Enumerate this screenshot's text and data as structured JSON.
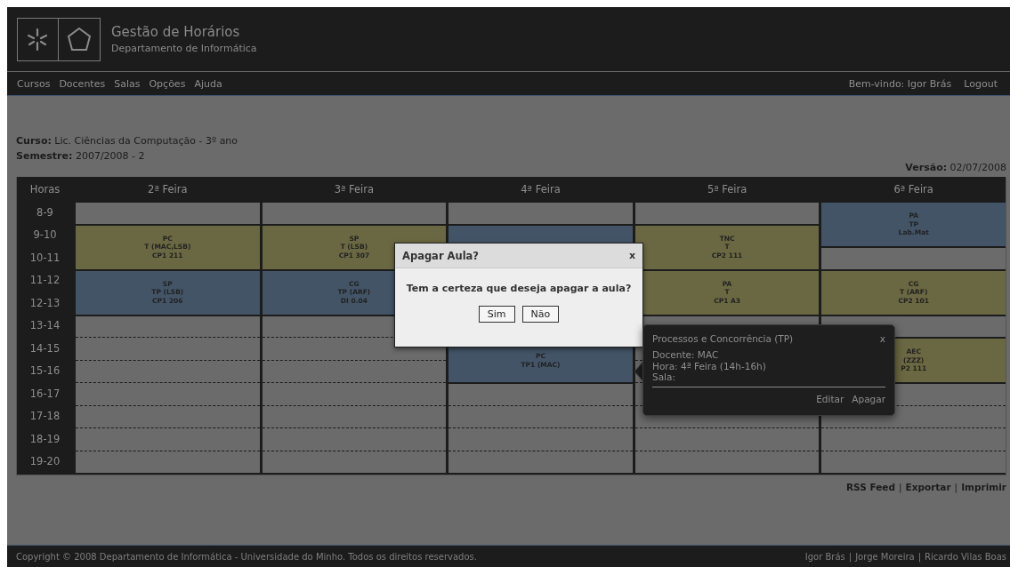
{
  "header": {
    "title": "Gestão de Horários",
    "subtitle": "Departamento de Informática"
  },
  "nav": {
    "items": [
      "Cursos",
      "Docentes",
      "Salas",
      "Opções",
      "Ajuda"
    ],
    "welcome": "Bem-vindo: Igor Brás",
    "logout": "Logout"
  },
  "info": {
    "course_label": "Curso:",
    "course": "Lic. Ciências da Computação - 3º ano",
    "semester_label": "Semestre:",
    "semester": "2007/2008 - 2",
    "version_label": "Versão:",
    "version": "02/07/2008"
  },
  "timetable": {
    "hours_heading": "Horas",
    "hours": [
      "8-9",
      "9-10",
      "10-11",
      "11-12",
      "12-13",
      "13-14",
      "14-15",
      "15-16",
      "16-17",
      "17-18",
      "18-19",
      "19-20"
    ],
    "days": [
      {
        "name": "2ª Feira",
        "slots": [
          {
            "kind": "free"
          },
          {
            "kind": "lesson",
            "color": "#6a6842",
            "lines": [
              "PC",
              "T (MAC,LSB)",
              "CP1 211"
            ]
          },
          {
            "kind": "continued"
          },
          {
            "kind": "lesson",
            "color": "#435467",
            "lines": [
              "SP",
              "TP (LSB)",
              "CP1 206"
            ]
          },
          {
            "kind": "continued"
          },
          {
            "kind": "free"
          },
          {
            "kind": "free"
          },
          {
            "kind": "free"
          },
          {
            "kind": "free"
          },
          {
            "kind": "free"
          },
          {
            "kind": "free"
          },
          {
            "kind": "free"
          }
        ]
      },
      {
        "name": "3ª Feira",
        "slots": [
          {
            "kind": "free"
          },
          {
            "kind": "lesson",
            "color": "#6a6842",
            "lines": [
              "SP",
              "T (LSB)",
              "CP1 307"
            ]
          },
          {
            "kind": "continued"
          },
          {
            "kind": "lesson",
            "color": "#435467",
            "lines": [
              "CG",
              "TP (ARF)",
              "DI 0.04"
            ]
          },
          {
            "kind": "continued"
          },
          {
            "kind": "free"
          },
          {
            "kind": "free"
          },
          {
            "kind": "free"
          },
          {
            "kind": "free"
          },
          {
            "kind": "free"
          },
          {
            "kind": "free"
          },
          {
            "kind": "free"
          }
        ]
      },
      {
        "name": "4ª Feira",
        "slots": [
          {
            "kind": "free"
          },
          {
            "kind": "lesson",
            "color": "#435467"
          },
          {
            "kind": "continued"
          },
          {
            "kind": "covered"
          },
          {
            "kind": "covered"
          },
          {
            "kind": "covered"
          },
          {
            "kind": "lesson",
            "color": "#435467",
            "lines": [
              "PC",
              "TP1 (MAC)"
            ]
          },
          {
            "kind": "continued"
          },
          {
            "kind": "free"
          },
          {
            "kind": "free"
          },
          {
            "kind": "free"
          },
          {
            "kind": "free"
          }
        ]
      },
      {
        "name": "5ª Feira",
        "slots": [
          {
            "kind": "free"
          },
          {
            "kind": "lesson",
            "color": "#6a6842",
            "lines": [
              "TNC",
              "T",
              "CP2 111"
            ]
          },
          {
            "kind": "continued"
          },
          {
            "kind": "lesson",
            "color": "#6a6842",
            "lines": [
              "PA",
              "T",
              "CP1 A3"
            ]
          },
          {
            "kind": "continued"
          },
          {
            "kind": "free"
          },
          {
            "kind": "free"
          },
          {
            "kind": "free"
          },
          {
            "kind": "free"
          },
          {
            "kind": "free"
          },
          {
            "kind": "free"
          },
          {
            "kind": "free"
          }
        ]
      },
      {
        "name": "6ª Feira",
        "slots": [
          {
            "kind": "lesson",
            "color": "#435467",
            "lines": [
              "PA",
              "TP",
              "Lab.Mat"
            ]
          },
          {
            "kind": "continued"
          },
          {
            "kind": "free"
          },
          {
            "kind": "lesson",
            "color": "#6a6842",
            "lines": [
              "CG",
              "T (ARF)",
              "CP2 101"
            ]
          },
          {
            "kind": "continued"
          },
          {
            "kind": "free"
          },
          {
            "kind": "lesson",
            "color": "#6a6842",
            "lines": [
              "AEC",
              "(ZZZ)",
              "P2 111"
            ]
          },
          {
            "kind": "continued"
          },
          {
            "kind": "free"
          },
          {
            "kind": "free"
          },
          {
            "kind": "free"
          },
          {
            "kind": "free"
          }
        ]
      }
    ]
  },
  "links": {
    "items": [
      "RSS Feed",
      "Exportar",
      "Imprimir"
    ],
    "separator": "|"
  },
  "dialog": {
    "title": "Apagar Aula?",
    "close": "x",
    "message": "Tem a certeza que deseja apagar a aula?",
    "buttons": [
      "Sim",
      "Não"
    ]
  },
  "popover": {
    "title": "Processos e Concorrência (TP)",
    "close": "x",
    "lines": [
      "Docente: MAC",
      "Hora: 4ª Feira (14h-16h)",
      "Sala:"
    ],
    "actions": [
      "Editar",
      "Apagar"
    ]
  },
  "footer": {
    "copyright": "Copyright © 2008 Departamento de Informática - Universidade do Minho. Todos os direitos reservados.",
    "authors": [
      "Igor Brás",
      "Jorge Moreira",
      "Ricardo Vilas Boas"
    ],
    "separator": "|"
  }
}
